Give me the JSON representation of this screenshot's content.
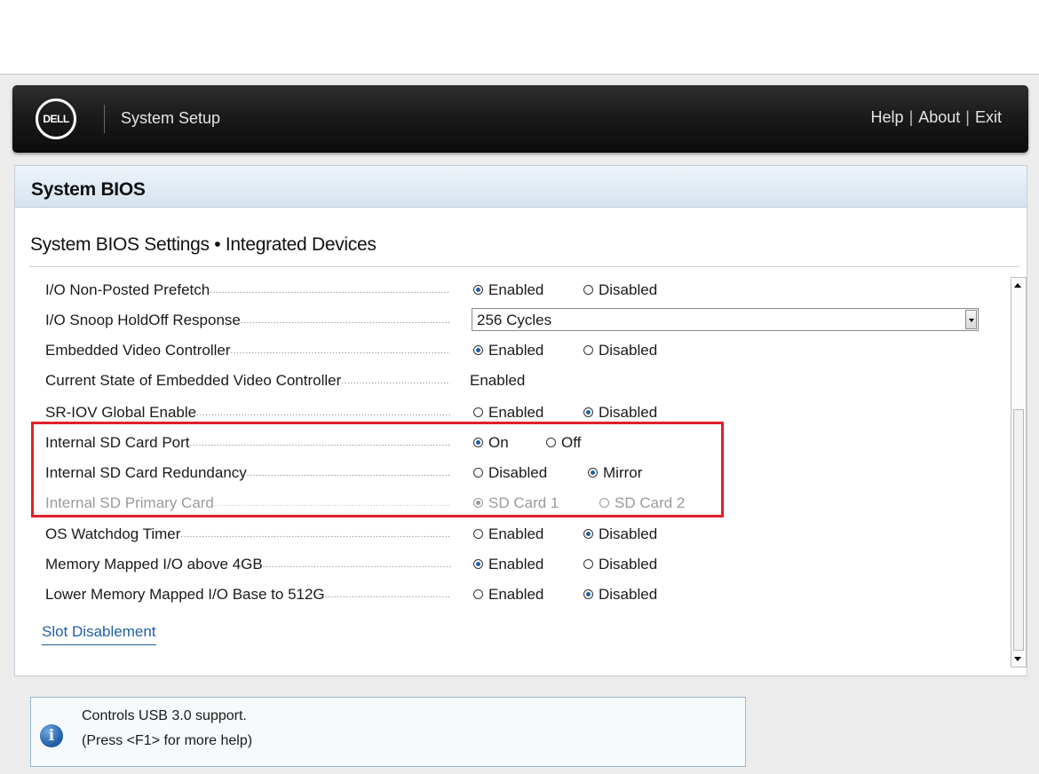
{
  "header": {
    "logo_text": "DELL",
    "app_title": "System Setup",
    "links": [
      "Help",
      "About",
      "Exit"
    ]
  },
  "panel": {
    "title": "System BIOS",
    "section_title": "System BIOS Settings • Integrated Devices"
  },
  "settings": [
    {
      "label": "I/O Non-Posted Prefetch",
      "options": [
        "Enabled",
        "Disabled"
      ],
      "selected": "Enabled"
    },
    {
      "label": "I/O Snoop HoldOff Response",
      "select_value": "256 Cycles"
    },
    {
      "label": "Embedded Video Controller",
      "options": [
        "Enabled",
        "Disabled"
      ],
      "selected": "Enabled"
    },
    {
      "label": "Current State of Embedded Video Controller",
      "value": "Enabled"
    },
    {
      "label": "SR-IOV Global Enable",
      "options": [
        "Enabled",
        "Disabled"
      ],
      "selected": "Disabled"
    },
    {
      "label": "Internal SD Card Port",
      "options": [
        "On",
        "Off"
      ],
      "selected": "On"
    },
    {
      "label": "Internal SD Card Redundancy",
      "options": [
        "Disabled",
        "Mirror"
      ],
      "selected": "Mirror"
    },
    {
      "label": "Internal SD Primary Card",
      "options": [
        "SD Card 1",
        "SD Card 2"
      ],
      "selected": "SD Card 1",
      "disabled": true
    },
    {
      "label": "OS Watchdog Timer",
      "options": [
        "Enabled",
        "Disabled"
      ],
      "selected": "Disabled"
    },
    {
      "label": "Memory Mapped I/O above 4GB",
      "options": [
        "Enabled",
        "Disabled"
      ],
      "selected": "Enabled"
    },
    {
      "label": "Lower Memory Mapped I/O Base to 512G",
      "options": [
        "Enabled",
        "Disabled"
      ],
      "selected": "Disabled"
    }
  ],
  "link": {
    "slot_disablement": "Slot Disablement"
  },
  "help": {
    "line1": "Controls USB 3.0 support.",
    "line2": "(Press <F1> for more help)"
  },
  "colors": {
    "highlight": "#e0202a",
    "accent": "#1f5fa8"
  }
}
